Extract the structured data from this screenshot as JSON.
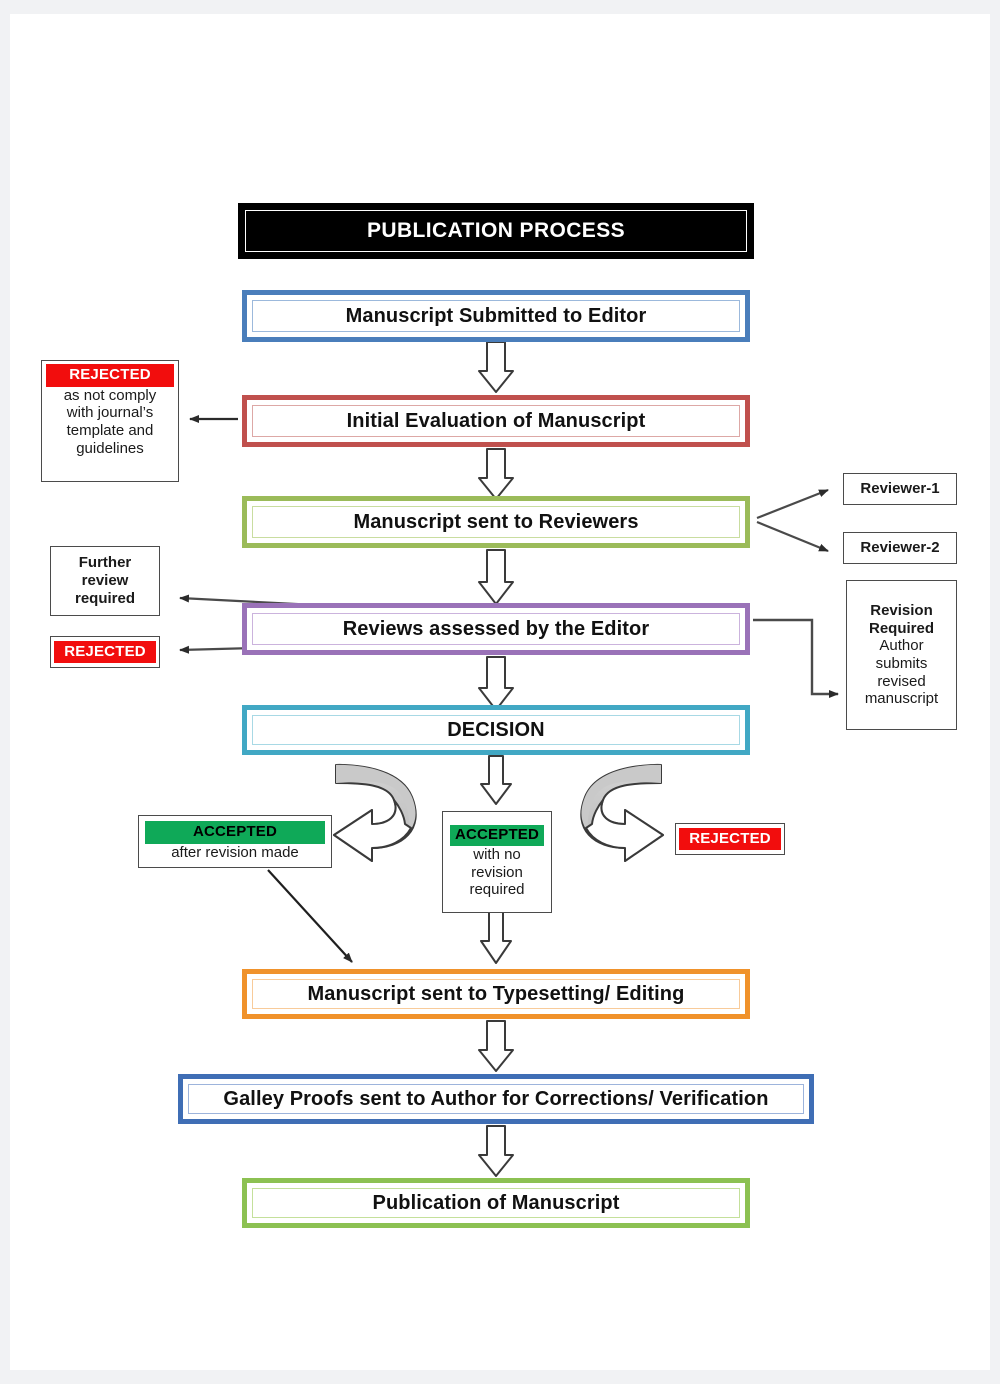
{
  "page": {
    "title": "PUBLICATION PROCESS",
    "background": "#f1f2f4",
    "sheet_color": "#ffffff"
  },
  "diagram": {
    "type": "flowchart",
    "title": "PUBLICATION PROCESS",
    "main_steps": [
      {
        "id": "submitted",
        "label": "Manuscript Submitted to Editor",
        "border_color": "#4a7ebb"
      },
      {
        "id": "initial",
        "label": "Initial Evaluation of Manuscript",
        "border_color": "#c0504d"
      },
      {
        "id": "to-review",
        "label": "Manuscript sent to Reviewers",
        "border_color": "#9bbb59"
      },
      {
        "id": "assessed",
        "label": "Reviews assessed by the Editor",
        "border_color": "#9a72b8"
      },
      {
        "id": "decision",
        "label": "DECISION",
        "border_color": "#41a8c4"
      },
      {
        "id": "typeset",
        "label": "Manuscript sent to Typesetting/ Editing",
        "border_color": "#f0922b"
      },
      {
        "id": "galley",
        "label": "Galley Proofs sent to Author for Corrections/ Verification",
        "border_color": "#3f6eb5"
      },
      {
        "id": "publication",
        "label": "Publication of Manuscript",
        "border_color": "#8cc152"
      }
    ],
    "side_nodes": {
      "rejected_template": {
        "tag": "REJECTED",
        "tag_color": "#f20d0d",
        "lines": [
          "as not comply",
          "with journal’s",
          "template and",
          "guidelines"
        ]
      },
      "further_review": {
        "lines": [
          "Further",
          "review",
          "required"
        ]
      },
      "rejected_after_review": {
        "tag": "REJECTED",
        "tag_color": "#f20d0d"
      },
      "reviewer_1": {
        "label": "Reviewer-1"
      },
      "reviewer_2": {
        "label": "Reviewer-2"
      },
      "revision_required": {
        "heading_lines": [
          "Revision",
          "Required"
        ],
        "lines": [
          "Author",
          "submits",
          "revised",
          "manuscript"
        ]
      },
      "accepted_after_revision": {
        "tag": "ACCEPTED",
        "tag_color": "#0fa958",
        "lines": [
          "after revision made"
        ]
      },
      "accepted_no_revision": {
        "tag": "ACCEPTED",
        "tag_color": "#0fa958",
        "lines": [
          "with no",
          "revision",
          "required"
        ]
      },
      "rejected_decision": {
        "tag": "REJECTED",
        "tag_color": "#f20d0d"
      }
    }
  }
}
